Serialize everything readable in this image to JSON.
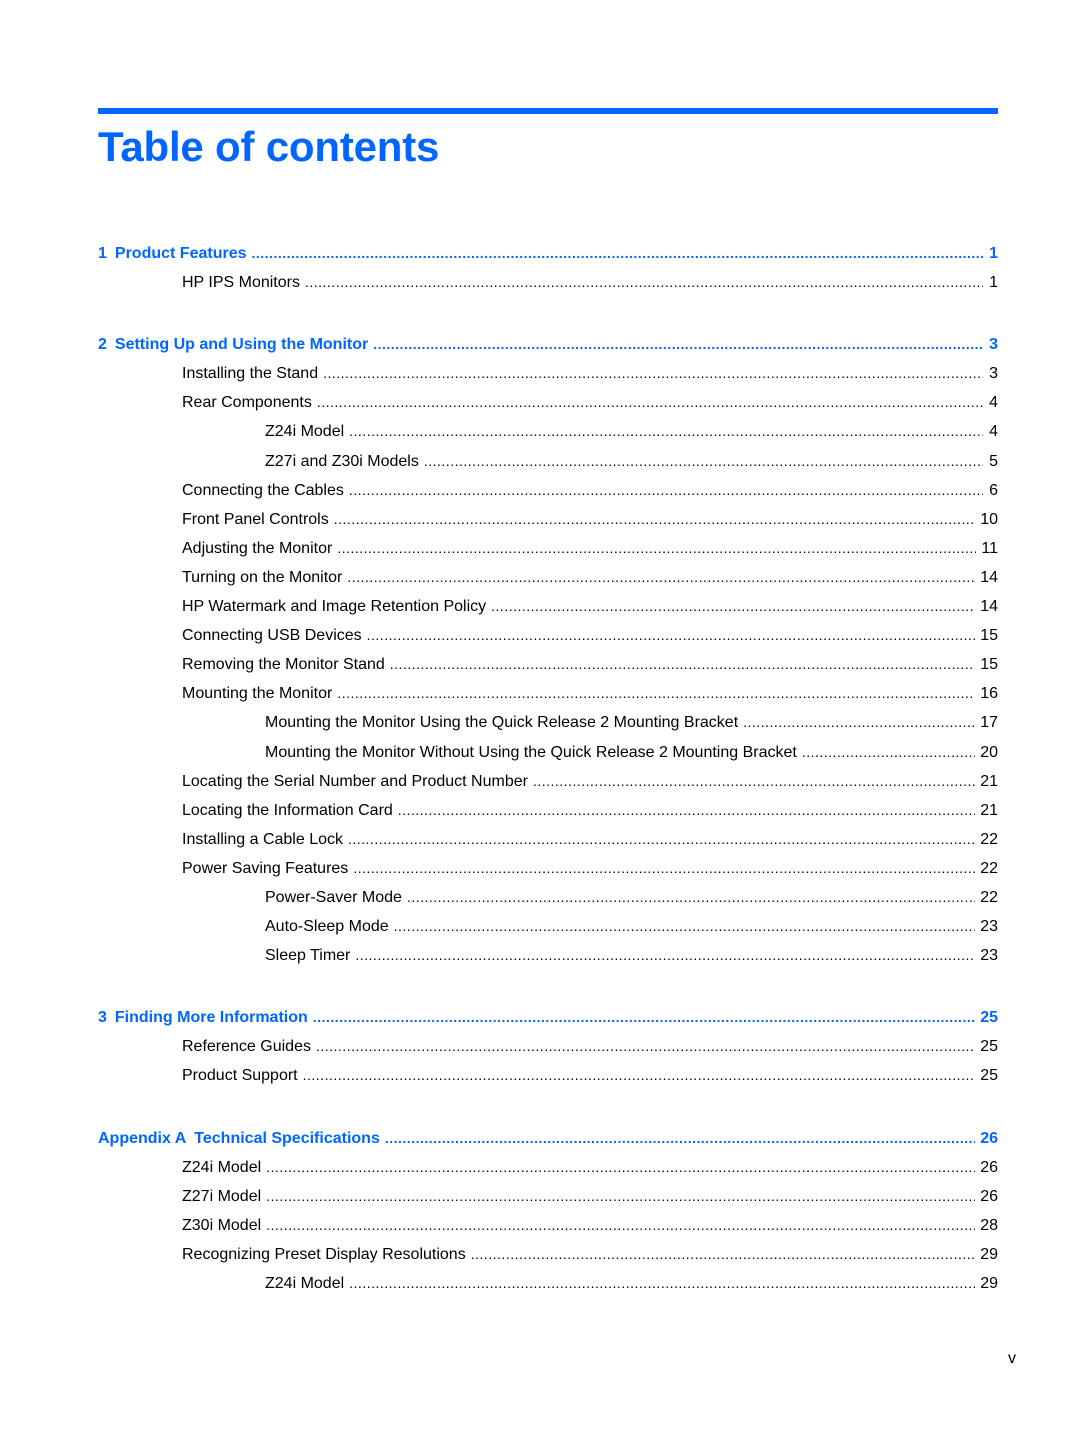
{
  "document": {
    "title": "Table of contents",
    "accent_color": "#0066ff",
    "page_number": "v"
  },
  "toc": [
    {
      "level": 0,
      "num": "1",
      "label": "Product Features",
      "page": "1"
    },
    {
      "level": 1,
      "label": "HP IPS Monitors",
      "page": "1"
    },
    {
      "level": 0,
      "num": "2",
      "label": "Setting Up and Using the Monitor",
      "page": "3"
    },
    {
      "level": 1,
      "label": "Installing the Stand",
      "page": "3"
    },
    {
      "level": 1,
      "label": "Rear Components",
      "page": "4"
    },
    {
      "level": 2,
      "label": "Z24i Model",
      "page": "4"
    },
    {
      "level": 2,
      "label": "Z27i and Z30i Models",
      "page": "5"
    },
    {
      "level": 1,
      "label": "Connecting the Cables",
      "page": "6"
    },
    {
      "level": 1,
      "label": "Front Panel Controls",
      "page": "10"
    },
    {
      "level": 1,
      "label": "Adjusting the Monitor",
      "page": "11"
    },
    {
      "level": 1,
      "label": "Turning on the Monitor",
      "page": "14"
    },
    {
      "level": 1,
      "label": "HP Watermark and Image Retention Policy",
      "page": "14"
    },
    {
      "level": 1,
      "label": "Connecting USB Devices",
      "page": "15"
    },
    {
      "level": 1,
      "label": "Removing the Monitor Stand",
      "page": "15"
    },
    {
      "level": 1,
      "label": "Mounting the Monitor",
      "page": "16"
    },
    {
      "level": 2,
      "label": "Mounting the Monitor Using the Quick Release 2 Mounting Bracket",
      "page": "17"
    },
    {
      "level": 2,
      "label": "Mounting the Monitor Without Using the Quick Release 2 Mounting Bracket",
      "page": "20"
    },
    {
      "level": 1,
      "label": "Locating the Serial Number and Product Number",
      "page": "21"
    },
    {
      "level": 1,
      "label": "Locating the Information Card",
      "page": "21"
    },
    {
      "level": 1,
      "label": "Installing a Cable Lock",
      "page": "22"
    },
    {
      "level": 1,
      "label": "Power Saving Features",
      "page": "22"
    },
    {
      "level": 2,
      "label": "Power-Saver Mode",
      "page": "22"
    },
    {
      "level": 2,
      "label": "Auto-Sleep Mode",
      "page": "23"
    },
    {
      "level": 2,
      "label": "Sleep Timer",
      "page": "23"
    },
    {
      "level": 0,
      "num": "3",
      "label": "Finding More Information",
      "page": "25"
    },
    {
      "level": 1,
      "label": "Reference Guides",
      "page": "25"
    },
    {
      "level": 1,
      "label": "Product Support",
      "page": "25"
    },
    {
      "level": 0,
      "num": "Appendix A",
      "label": "Technical Specifications",
      "page": "26"
    },
    {
      "level": 1,
      "label": "Z24i Model",
      "page": "26"
    },
    {
      "level": 1,
      "label": "Z27i Model",
      "page": "26"
    },
    {
      "level": 1,
      "label": "Z30i Model",
      "page": "28"
    },
    {
      "level": 1,
      "label": "Recognizing Preset Display Resolutions",
      "page": "29"
    },
    {
      "level": 2,
      "label": "Z24i Model",
      "page": "29"
    }
  ]
}
